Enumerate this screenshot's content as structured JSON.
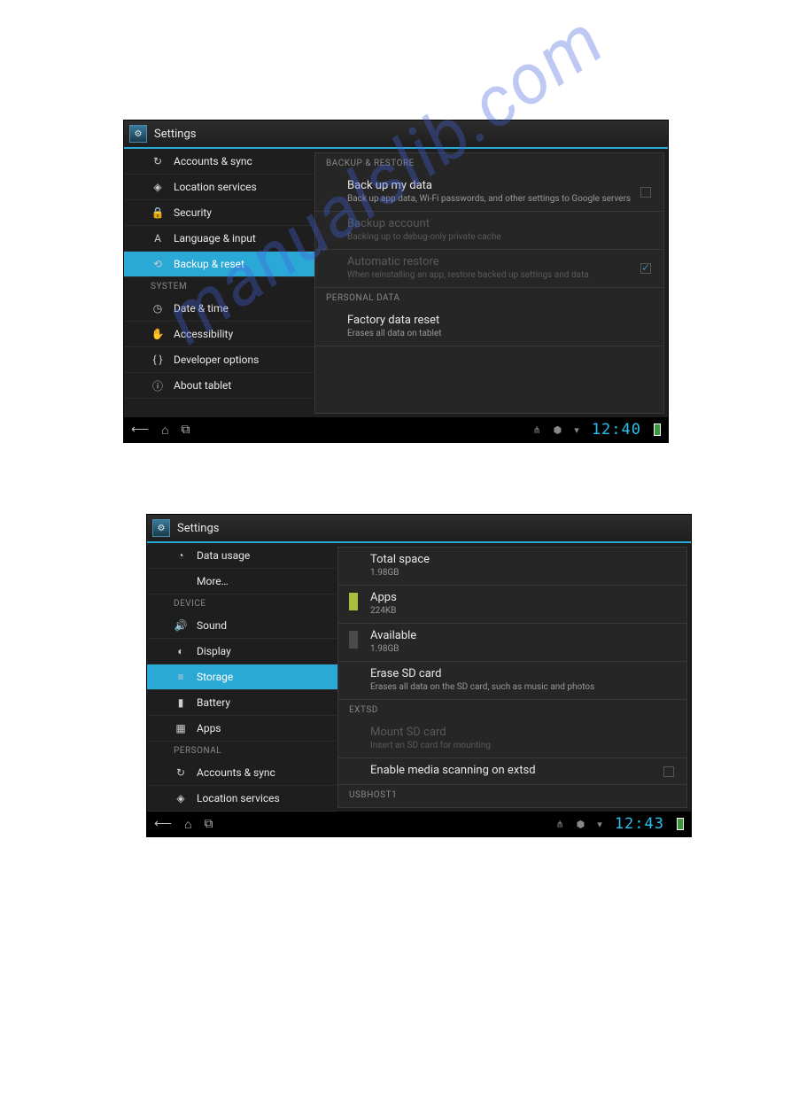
{
  "watermark": "manualslib.com",
  "shot1": {
    "title": "Settings",
    "sidebar": {
      "items_top": [
        {
          "icon": "↻",
          "label": "Accounts & sync"
        },
        {
          "icon": "◈",
          "label": "Location services"
        },
        {
          "icon": "🔒",
          "label": "Security"
        },
        {
          "icon": "A",
          "label": "Language & input"
        },
        {
          "icon": "⟲",
          "label": "Backup & reset",
          "selected": true
        }
      ],
      "section1": "SYSTEM",
      "items_sys": [
        {
          "icon": "◷",
          "label": "Date & time"
        },
        {
          "icon": "✋",
          "label": "Accessibility"
        },
        {
          "icon": "{ }",
          "label": "Developer options"
        },
        {
          "icon": "ⓘ",
          "label": "About tablet"
        }
      ]
    },
    "content": {
      "sec1": "BACKUP & RESTORE",
      "items1": [
        {
          "title": "Back up my data",
          "sub": "Back up app data, Wi-Fi passwords, and other settings to Google servers",
          "chk": "empty"
        },
        {
          "title": "Backup account",
          "sub": "Backing up to debug-only private cache",
          "disabled": true
        },
        {
          "title": "Automatic restore",
          "sub": "When reinstalling an app, restore backed up settings and data",
          "disabled": true,
          "chk": "checked"
        }
      ],
      "sec2": "PERSONAL DATA",
      "items2": [
        {
          "title": "Factory data reset",
          "sub": "Erases all data on tablet"
        }
      ]
    },
    "navbar": {
      "time": "12:40"
    }
  },
  "shot2": {
    "title": "Settings",
    "sidebar": {
      "items_top": [
        {
          "icon": "◔",
          "label": "Data usage"
        },
        {
          "icon": "",
          "label": "More…"
        }
      ],
      "sec1": "DEVICE",
      "items_dev": [
        {
          "icon": "🔊",
          "label": "Sound"
        },
        {
          "icon": "◐",
          "label": "Display"
        },
        {
          "icon": "≡",
          "label": "Storage",
          "selected": true
        },
        {
          "icon": "▮",
          "label": "Battery"
        },
        {
          "icon": "▦",
          "label": "Apps"
        }
      ],
      "sec2": "PERSONAL",
      "items_per": [
        {
          "icon": "↻",
          "label": "Accounts & sync"
        },
        {
          "icon": "◈",
          "label": "Location services"
        }
      ]
    },
    "content": {
      "items_top": [
        {
          "title": "Total space",
          "sub": "1.98GB"
        },
        {
          "title": "Apps",
          "sub": "224KB",
          "color": "#a8c040"
        },
        {
          "title": "Available",
          "sub": "1.98GB",
          "color": "#4a4a4a"
        },
        {
          "title": "Erase SD card",
          "sub": "Erases all data on the SD card, such as music and photos"
        }
      ],
      "sec1": "EXTSD",
      "items_ext": [
        {
          "title": "Mount SD card",
          "sub": "Insert an SD card for mounting",
          "disabled": true
        },
        {
          "title": "Enable media scanning on extsd",
          "chk": "empty"
        }
      ],
      "sec2": "USBHOST1"
    },
    "navbar": {
      "time": "12:43"
    }
  }
}
